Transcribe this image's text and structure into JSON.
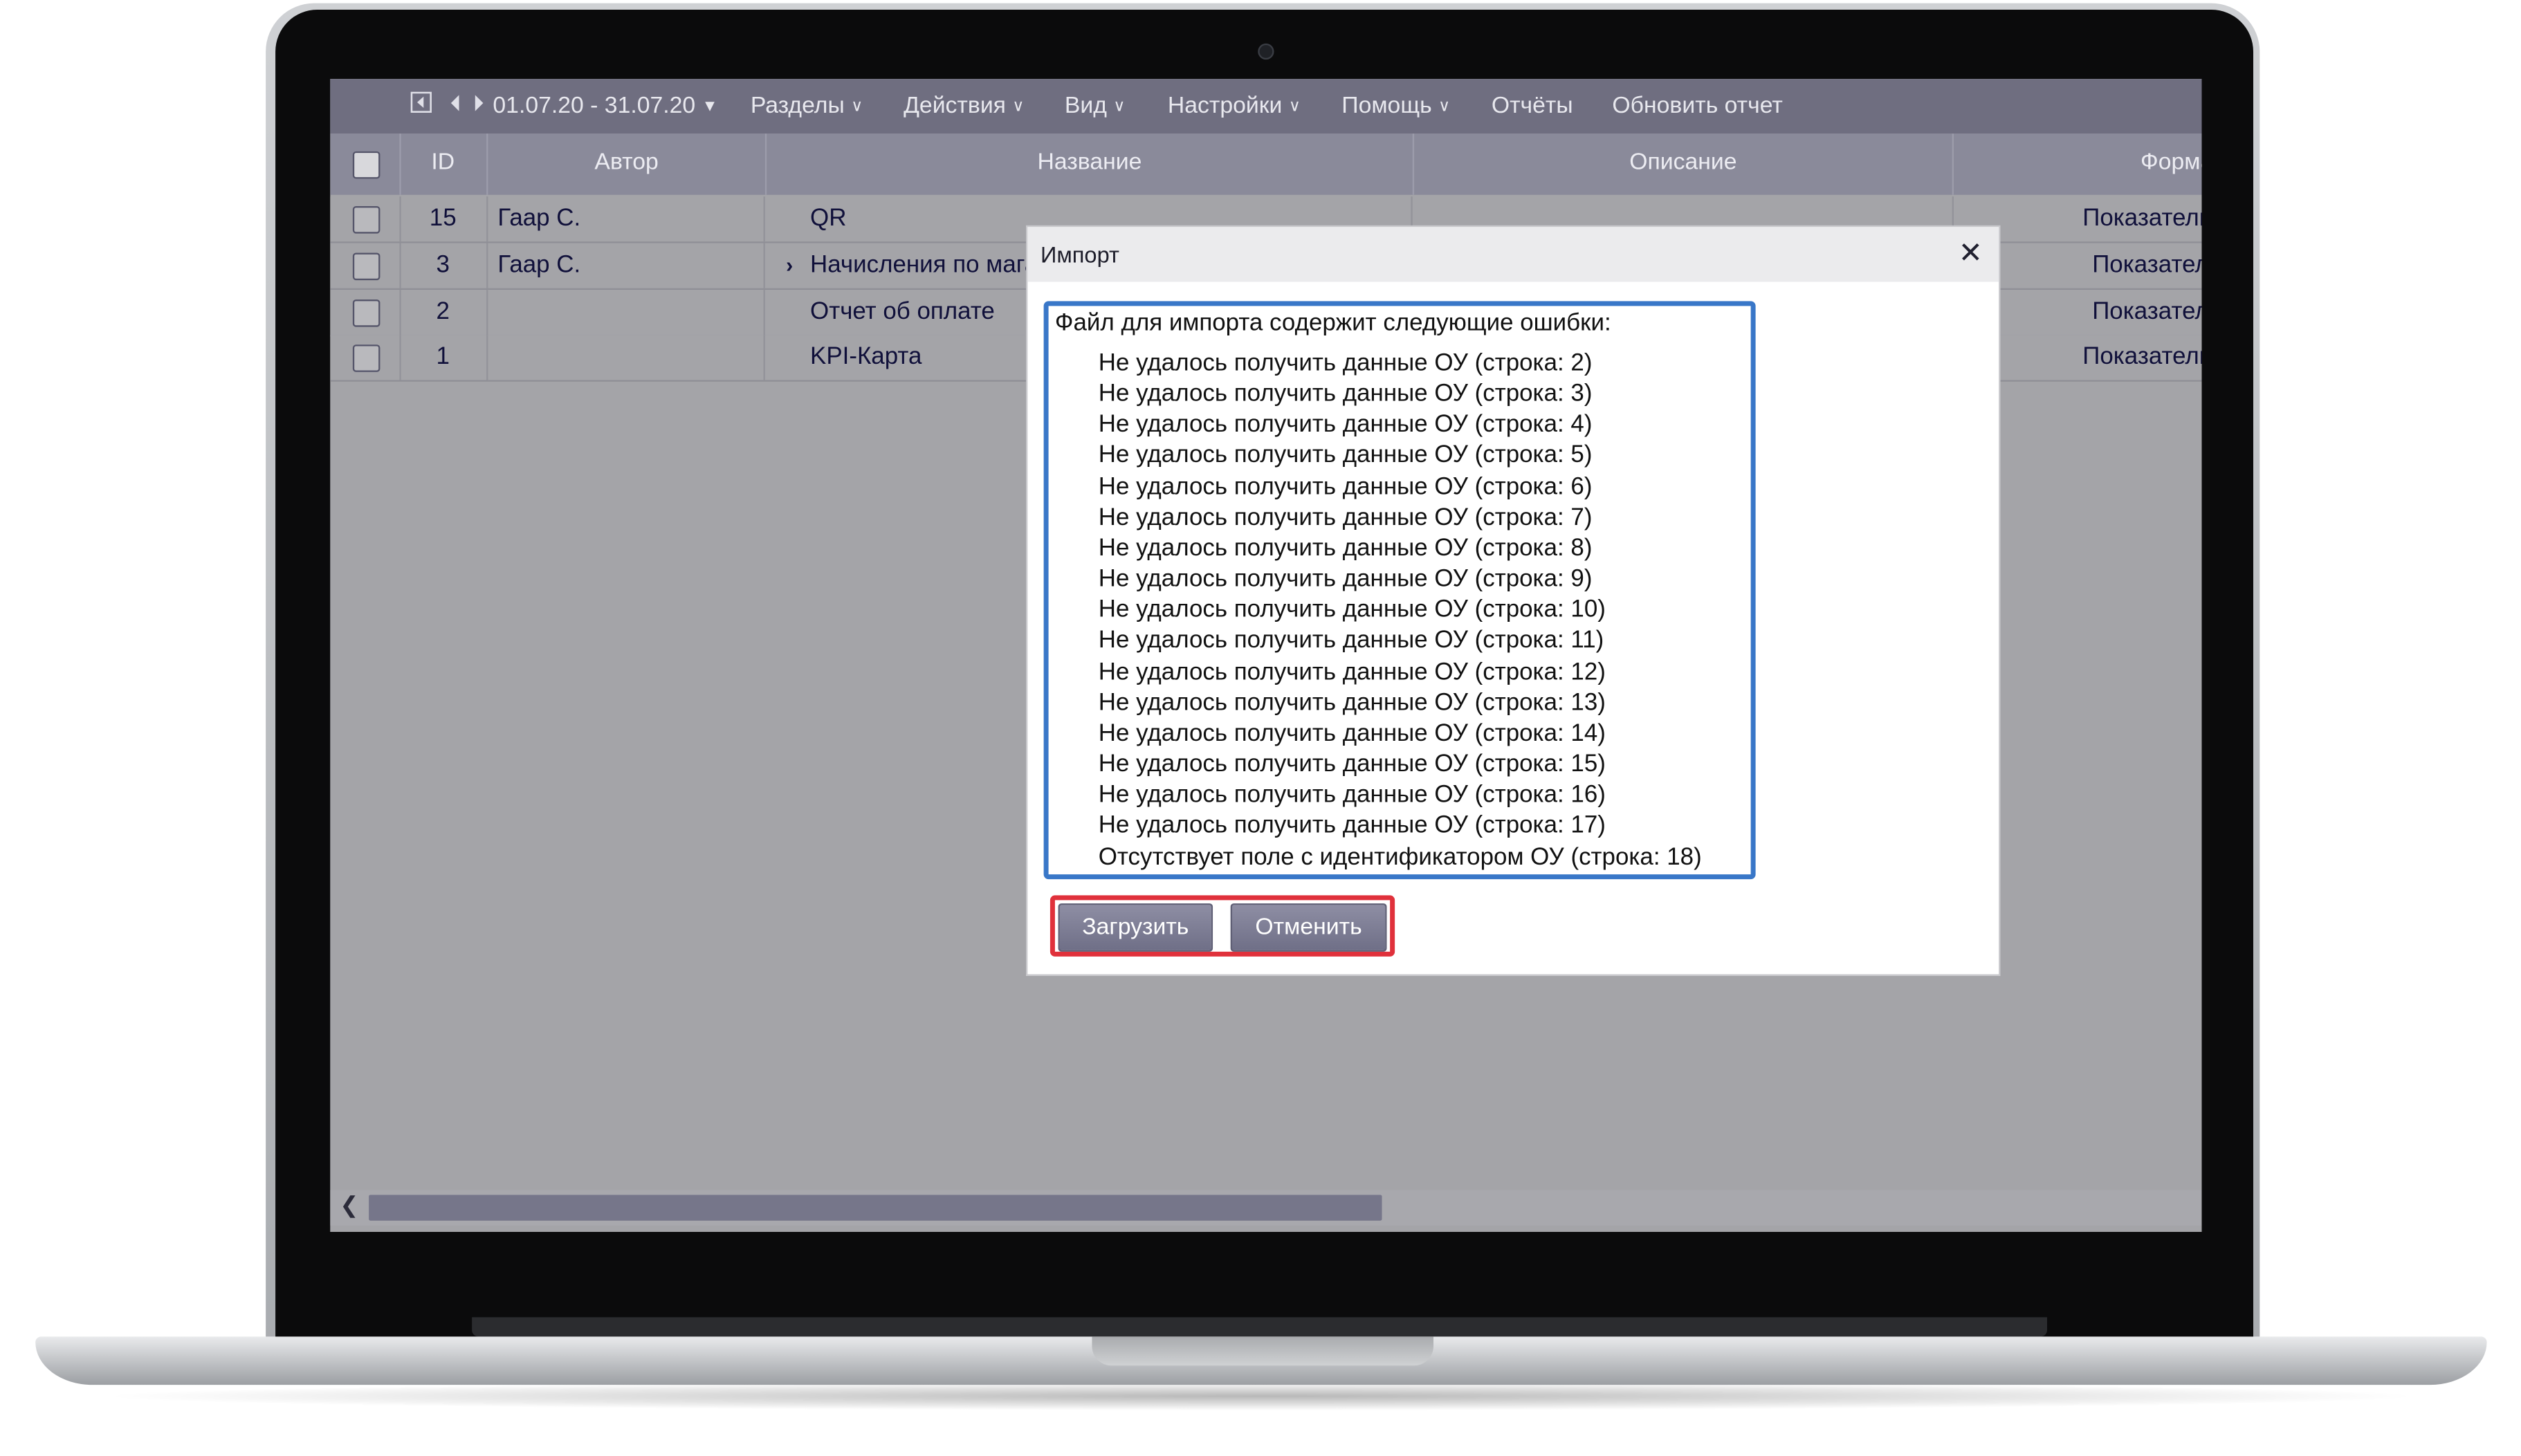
{
  "toolbar": {
    "date_range": "01.07.20 - 31.07.20",
    "menus": [
      "Разделы",
      "Действия",
      "Вид",
      "Настройки",
      "Помощь"
    ],
    "reports": "Отчёты",
    "refresh": "Обновить отчет"
  },
  "table": {
    "columns": [
      "ID",
      "Автор",
      "Название",
      "Описание",
      "Форма"
    ],
    "rows": [
      {
        "id": "15",
        "author": "Гаар С.",
        "name": "QR",
        "form": "Показатель"
      },
      {
        "id": "3",
        "author": "Гаар С.",
        "name": "Начисления по магазинам",
        "form": "Показатель"
      },
      {
        "id": "2",
        "author": "",
        "name": "Отчет об оплате",
        "form": "Показатель"
      },
      {
        "id": "1",
        "author": "",
        "name": "KPI-Карта",
        "form": "Показатель"
      }
    ]
  },
  "dialog": {
    "title": "Импорт",
    "close_symbol": "✕",
    "error_header": "Файл для импорта содержит следующие ошибки:",
    "errors": [
      "Не удалось получить данные ОУ (строка: 2)",
      "Не удалось получить данные ОУ (строка: 3)",
      "Не удалось получить данные ОУ (строка: 4)",
      "Не удалось получить данные ОУ (строка: 5)",
      "Не удалось получить данные ОУ (строка: 6)",
      "Не удалось получить данные ОУ (строка: 7)",
      "Не удалось получить данные ОУ (строка: 8)",
      "Не удалось получить данные ОУ (строка: 9)",
      "Не удалось получить данные ОУ (строка: 10)",
      "Не удалось получить данные ОУ (строка: 11)",
      "Не удалось получить данные ОУ (строка: 12)",
      "Не удалось получить данные ОУ (строка: 13)",
      "Не удалось получить данные ОУ (строка: 14)",
      "Не удалось получить данные ОУ (строка: 15)",
      "Не удалось получить данные ОУ (строка: 16)",
      "Не удалось получить данные ОУ (строка: 17)",
      "Отсутствует поле с идентификатором ОУ (строка: 18)"
    ],
    "load_button": "Загрузить",
    "cancel_button": "Отменить"
  },
  "colors": {
    "toolbar_bg": "#6f6e80",
    "header_bg": "#8a8a9a",
    "overlay_bg": "#a4a4a8",
    "error_border": "#3977c8",
    "highlight_border": "#e0313b"
  },
  "icons": {
    "first_page": "first-page-icon",
    "prev": "prev-arrow-icon",
    "next": "next-arrow-icon",
    "dropdown": "chevron-down-icon",
    "expand": "expand-row-icon",
    "close": "close-icon",
    "scroll_left": "scroll-left-icon"
  }
}
